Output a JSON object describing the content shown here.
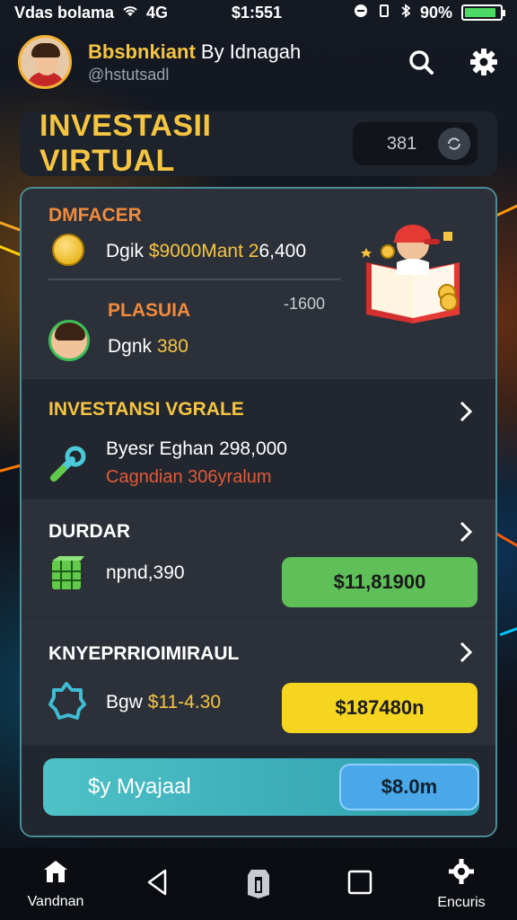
{
  "status": {
    "left_text": "Vdas bolama",
    "network": "4G",
    "time": "$1:551",
    "battery": "90%",
    "battery_level": 0.9
  },
  "header": {
    "name_highlight": "Bbsbnkiant",
    "name_rest": " By Idnagah",
    "handle": "@hstutsadl"
  },
  "title_bar": {
    "title": "INVESTASII VIRTUAL",
    "count": "381"
  },
  "section1": {
    "label": "DMFACER",
    "row1_prefix": "Dgik ",
    "row1_highlight": "$9000Mant 2",
    "row1_suffix": "6,400",
    "label2": "PLASUIA",
    "side_value": "-1600",
    "row2_prefix": "Dgnk ",
    "row2_highlight": "380"
  },
  "section2": {
    "label": "INVESTANSI VGRALE",
    "line1": "Byesr Eghan 298,000",
    "line2": "Cagndian 306yralum"
  },
  "section3": {
    "label": "DURDAR",
    "value": "npnd,390",
    "button": "$11,81900"
  },
  "section4": {
    "label": "KNYEPRRIOIMIRAUL",
    "value_prefix": "Bgw ",
    "value_highlight": "$11-4.30",
    "button": "$187480n"
  },
  "section5": {
    "bar_label": "$y Myajaal",
    "button": "$8.0m"
  },
  "nav": {
    "home": "Vandnan",
    "settings": "Encuris"
  },
  "colors": {
    "accent_yellow": "#f5c542",
    "accent_orange": "#f08a3c",
    "button_green": "#5fbf58",
    "button_yellow": "#f5d520",
    "button_blue": "#4aa8e8"
  },
  "icons": {
    "status": [
      "wifi-icon",
      "bluetooth-icon",
      "battery-icon"
    ],
    "header": [
      "search-icon",
      "gear-icon"
    ],
    "nav": [
      "home-icon",
      "back-icon",
      "app-icon",
      "recents-icon",
      "settings-icon"
    ]
  }
}
